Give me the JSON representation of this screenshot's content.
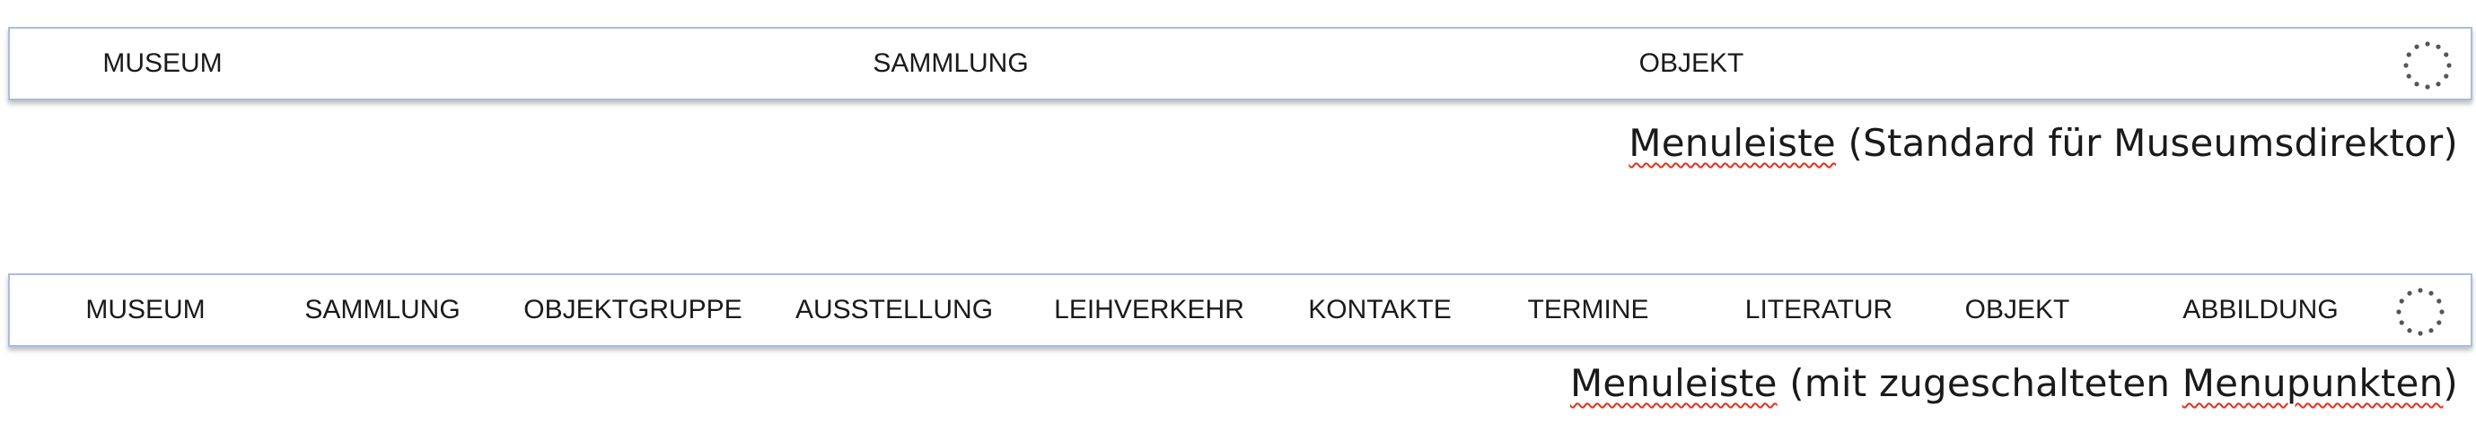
{
  "menubar_director": {
    "items": [
      "MUSEUM",
      "SAMMLUNG",
      "OBJEKT"
    ],
    "caption_word": "Menuleiste",
    "caption_rest": " (Standard für Museumsdirektor)"
  },
  "menubar_extended": {
    "items": [
      "MUSEUM",
      "SAMMLUNG",
      "OBJEKTGRUPPE",
      "AUSSTELLUNG",
      "LEIHVERKEHR",
      "KONTAKTE",
      "TERMINE",
      "LITERATUR",
      "OBJEKT",
      "ABBILDUNG"
    ],
    "caption_word": "Menuleiste",
    "caption_mid": " (mit zugeschalteten ",
    "caption_word2": "Menupunkten",
    "caption_end": ")"
  },
  "icons": {
    "spinner": "loading-spinner-icon"
  },
  "colors": {
    "bar_border": "#a8bde0",
    "spinner_dots": "#555555",
    "spellcheck": "#e0321a"
  }
}
